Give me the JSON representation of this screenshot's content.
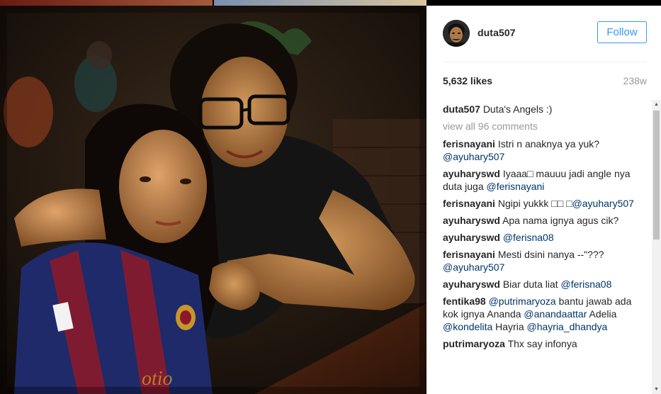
{
  "post": {
    "username": "duta507",
    "follow_label": "Follow",
    "likes": "5,632 likes",
    "time": "238w"
  },
  "caption": {
    "user": "duta507",
    "text": "Duta's Angels :)"
  },
  "view_all": "view all 96 comments",
  "comments": [
    {
      "user": "ferisnayani",
      "text": "Istri n anaknya ya yuk?",
      "mention": "@ayuhary507"
    },
    {
      "user": "ayuharyswd",
      "text": "Iyaaa□ mauuu jadi angle nya duta juga",
      "mention": "@ferisnayani"
    },
    {
      "user": "ferisnayani",
      "text": "Ngipi yukkk □□ □",
      "mention": "@ayuhary507"
    },
    {
      "user": "ayuharyswd",
      "text": "Apa nama ignya agus cik?",
      "mention": ""
    },
    {
      "user": "ayuharyswd",
      "text": "",
      "mention": "@ferisna08"
    },
    {
      "user": "ferisnayani",
      "text": "Mesti dsini nanya --\"???",
      "mention": "@ayuhary507"
    },
    {
      "user": "ayuharyswd",
      "text": "Biar duta liat",
      "mention": "@ferisna08"
    },
    {
      "user": "fentika98",
      "text_parts": [
        "@putrimaryoza",
        " bantu jawab ada kok ignya Ananda ",
        "@anandaattar",
        " Adelia ",
        "@kondelita",
        " Hayria ",
        "@hayria_dhandya"
      ]
    },
    {
      "user": "putrimaryoza",
      "text": "Thx say infonya",
      "mention": ""
    }
  ]
}
